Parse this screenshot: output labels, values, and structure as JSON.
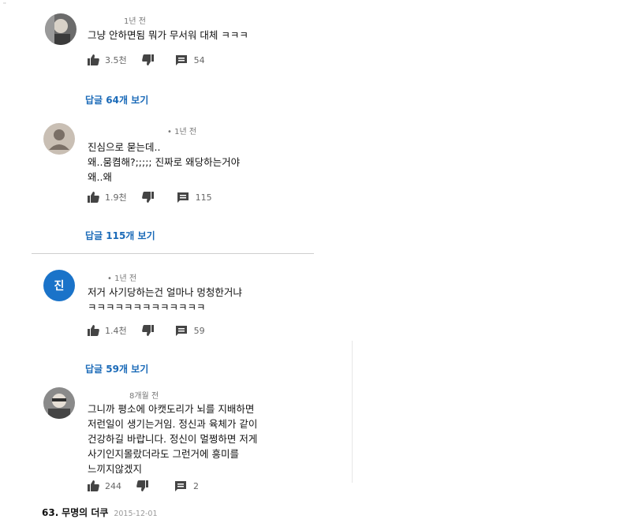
{
  "corner_mark": "''",
  "comments": [
    {
      "time": "1년 전",
      "lines": [
        "그냥 안하면됨 뭐가 무서워 대체 ㅋㅋㅋ"
      ],
      "likes": "3.5천",
      "reply_count": "54",
      "replies_link": "답글 64개 보기"
    },
    {
      "time": "• 1년 전",
      "lines": [
        "진심으로 묻는데..",
        "왜..뭄켬해?;;;;; 진짜로 왜당하는거야",
        "왜..왜"
      ],
      "likes": "1.9천",
      "reply_count": "115",
      "replies_link": "답글 115개 보기"
    },
    {
      "avatar_initial": "진",
      "time": "• 1년 전",
      "lines": [
        "저거 사기당하는건 얼마나 멍청한거냐",
        "ㅋㅋㅋㅋㅋㅋㅋㅋㅋㅋㅋㅋㅋ"
      ],
      "likes": "1.4천",
      "reply_count": "59",
      "replies_link": "답글 59개 보기"
    },
    {
      "time": "8개월 전",
      "lines": [
        "그니까 평소에 아캣도리가 뇌를 지배하면",
        "저런일이 생기는거임. 정신과 육체가 같이",
        "건강하길 바랍니다. 정신이 멀쩡하면 저게",
        "사기인지몰랐더라도 그런거에 흥미를",
        "느끼지않겠지"
      ],
      "likes": "244",
      "reply_count": "2"
    }
  ],
  "footer": {
    "number": "63.",
    "name": "무명의 더쿠",
    "date": "2015-12-01"
  },
  "icons": {
    "like": "thumbs-up-icon",
    "dislike": "thumbs-down-icon",
    "reply": "comment-icon"
  },
  "colors": {
    "link": "#1a6ab8",
    "avatar_blue": "#1a73c9",
    "icon": "#444444"
  }
}
